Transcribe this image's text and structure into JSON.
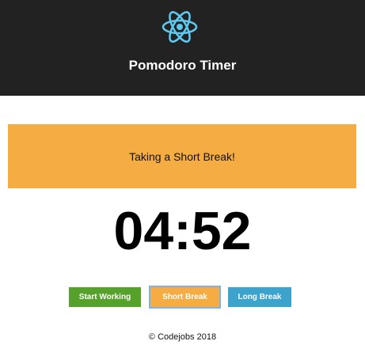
{
  "header": {
    "logo_icon": "react-atom-icon",
    "title": "Pomodoro Timer"
  },
  "status": {
    "message": "Taking a Short Break!"
  },
  "timer": {
    "display": "04:52"
  },
  "controls": {
    "start_label": "Start Working",
    "short_label": "Short Break",
    "long_label": "Long Break",
    "active": "Short Break"
  },
  "footer": {
    "text": "© Codejobs 2018"
  },
  "colors": {
    "header_bg": "#222222",
    "logo": "#5fc8ee",
    "banner": "#f4ac43",
    "start": "#55a12c",
    "short": "#f4ac43",
    "long": "#3ba3cc"
  }
}
